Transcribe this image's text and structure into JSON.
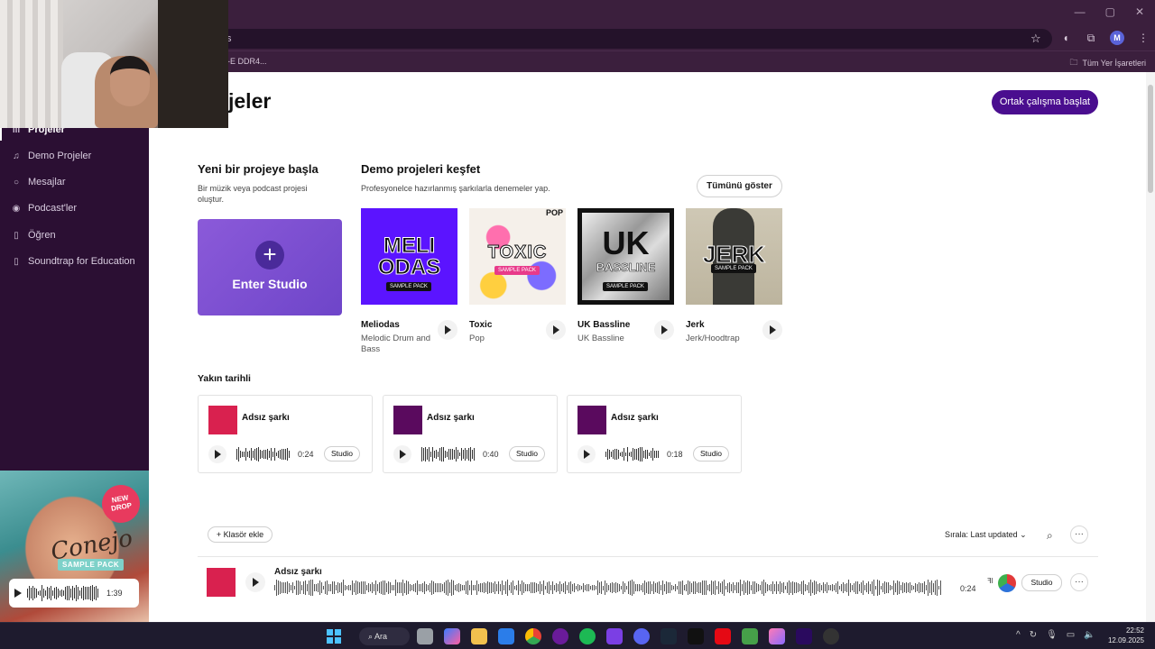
{
  "browser": {
    "address_text": "ts",
    "bookmark_left": "-E DDR4...",
    "bookmark_right": "Tüm Yer İşaretleri",
    "profile_initial": "M"
  },
  "sidebar": {
    "items": [
      {
        "label": "Projeler",
        "icon": "waveform-icon",
        "active": true
      },
      {
        "label": "Demo Projeler",
        "icon": "music-note-icon"
      },
      {
        "label": "Mesajlar",
        "icon": "chat-icon"
      },
      {
        "label": "Podcast'ler",
        "icon": "podcast-icon"
      },
      {
        "label": "Öğren",
        "icon": "book-icon"
      },
      {
        "label": "Soundtrap for Education",
        "icon": "education-icon"
      }
    ]
  },
  "promo": {
    "badge": "NEW DROP",
    "script": "Conejo",
    "pack": "SAMPLE PACK",
    "time": "1:39"
  },
  "header": {
    "title": "jeler",
    "collab_button": "Ortak çalışma başlat"
  },
  "new_project": {
    "title": "Yeni bir projeye başla",
    "subtitle": "Bir müzik veya podcast projesi oluştur.",
    "enter_studio": "Enter Studio"
  },
  "demos": {
    "title": "Demo projeleri keşfet",
    "subtitle": "Profesyonelce hazırlanmış şarkılarla denemeler yap.",
    "show_all": "Tümünü göster",
    "items": [
      {
        "name": "Meliodas",
        "genre": "Melodic Drum and Bass",
        "cover_line1": "MELI",
        "cover_line2": "ODAS",
        "chip": "SAMPLE PACK",
        "color": "#5b14ff"
      },
      {
        "name": "Toxic",
        "genre": "Pop",
        "cover_line1": "TOXIC",
        "cover_line2": "POP",
        "chip": "SAMPLE PACK",
        "color": "#f5f0ea"
      },
      {
        "name": "UK Bassline",
        "genre": "UK Bassline",
        "cover_line1": "UK",
        "cover_line2": "BASSLINE",
        "chip": "SAMPLE PACK",
        "color": "#bdbdbd"
      },
      {
        "name": "Jerk",
        "genre": "Jerk/Hoodtrap",
        "cover_line1": "JERK",
        "cover_line2": "",
        "chip": "SAMPLE PACK",
        "color": "#d9d4c4"
      }
    ]
  },
  "recent": {
    "title": "Yakın tarihli",
    "studio_label": "Studio",
    "cards": [
      {
        "title": "Adsız şarkı",
        "time": "0:24",
        "color": "#d9214f"
      },
      {
        "title": "Adsız şarkı",
        "time": "0:40",
        "color": "#5a0a5e"
      },
      {
        "title": "Adsız şarkı",
        "time": "0:18",
        "color": "#5a0a5e"
      }
    ]
  },
  "list": {
    "add_folder": "+ Klasör ekle",
    "sort_prefix": "Sırala:",
    "sort_value": "Last updated",
    "more": "···",
    "rows": [
      {
        "title": "Adsız şarkı",
        "time": "0:24",
        "studio": "Studio"
      }
    ]
  },
  "taskbar": {
    "search": "Ara",
    "time": "22:52",
    "date": "12.09.2025"
  }
}
